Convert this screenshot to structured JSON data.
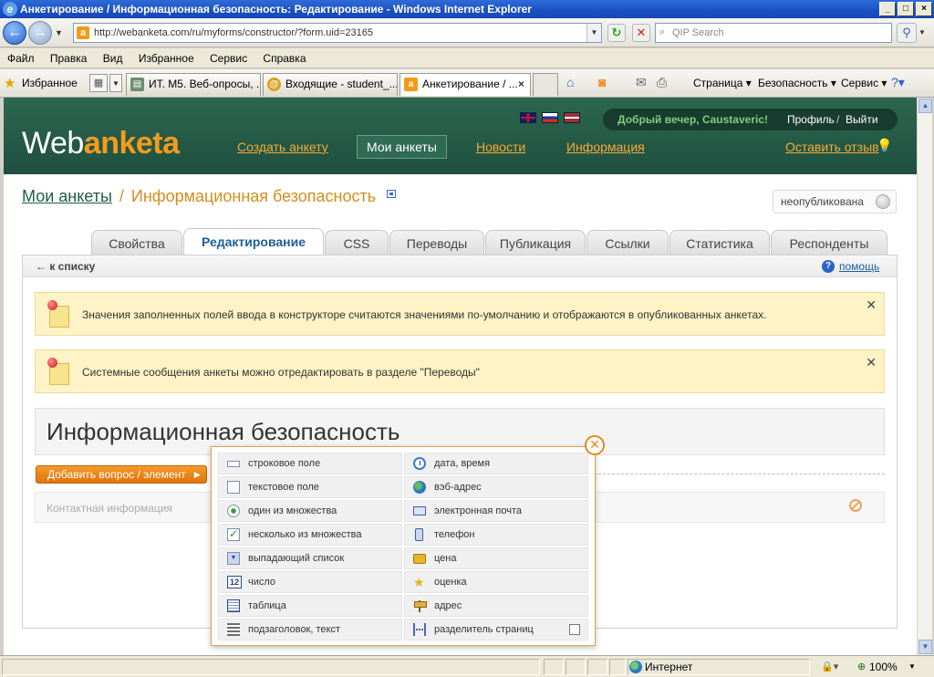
{
  "browser": {
    "title": "Анкетирование / Информационная безопасность: Редактирование - Windows Internet Explorer",
    "url": "http://webanketa.com/ru/myforms/constructor/?form.uid=23165",
    "search_placeholder": "QIP Search",
    "menu": [
      "Файл",
      "Правка",
      "Вид",
      "Избранное",
      "Сервис",
      "Справка"
    ],
    "favorites_label": "Избранное",
    "tabs": [
      {
        "label": "ИТ. М5. Веб-опросы, ..."
      },
      {
        "label": "Входящие - student_..."
      },
      {
        "label": "Анкетирование / ..."
      }
    ],
    "commands": {
      "page": "Страница",
      "security": "Безопасность",
      "tools": "Сервис"
    },
    "status": {
      "zone": "Интернет",
      "zoom": "100%"
    }
  },
  "site": {
    "logo_web": "Web",
    "logo_anketa": "anketa",
    "nav": [
      "Создать анкету",
      "Мои анкеты",
      "Новости",
      "Информация"
    ],
    "greeting": "Добрый вечер, Caustaveric!",
    "profile": "Профиль",
    "separator": "/",
    "logout": "Выйти",
    "feedback": "Оставить отзыв"
  },
  "page": {
    "breadcrumb_root": "Мои анкеты",
    "breadcrumb_sep": "/",
    "breadcrumb_current": "Информационная безопасность",
    "status": "неопубликована",
    "tabs": [
      "Свойства",
      "Редактирование",
      "CSS",
      "Переводы",
      "Публикация",
      "Ссылки",
      "Статистика",
      "Респонденты"
    ],
    "active_tab": "Редактирование",
    "back_link": "← к списку",
    "help_link": "помощь",
    "notes": [
      "Значения заполненных полей ввода в конструкторе считаются значениями по-умолчанию и отображаются в опубликованных анкетах.",
      "Системные сообщения анкеты можно отредактировать в разделе \"Переводы\""
    ],
    "form_title": "Информационная безопасность",
    "add_button": "Добавить вопрос / элемент",
    "contact_row": "Контактная информация"
  },
  "element_menu": {
    "left": [
      {
        "label": "строковое поле",
        "icon": "text-line-icon"
      },
      {
        "label": "текстовое поле",
        "icon": "textarea-icon"
      },
      {
        "label": "один из множества",
        "icon": "radio-icon"
      },
      {
        "label": "несколько из множества",
        "icon": "checkbox-icon"
      },
      {
        "label": "выпадающий список",
        "icon": "dropdown-icon"
      },
      {
        "label": "число",
        "icon": "number-icon"
      },
      {
        "label": "таблица",
        "icon": "table-icon"
      },
      {
        "label": "подзаголовок, текст",
        "icon": "heading-icon"
      }
    ],
    "right": [
      {
        "label": "дата, время",
        "icon": "clock-icon"
      },
      {
        "label": "вэб-адрес",
        "icon": "globe-icon"
      },
      {
        "label": "электронная почта",
        "icon": "mail-icon"
      },
      {
        "label": "телефон",
        "icon": "phone-icon"
      },
      {
        "label": "цена",
        "icon": "price-icon"
      },
      {
        "label": "оценка",
        "icon": "star-icon"
      },
      {
        "label": "адрес",
        "icon": "signpost-icon"
      },
      {
        "label": "разделитель страниц",
        "icon": "page-break-icon"
      }
    ],
    "number_icon_text": "12"
  }
}
